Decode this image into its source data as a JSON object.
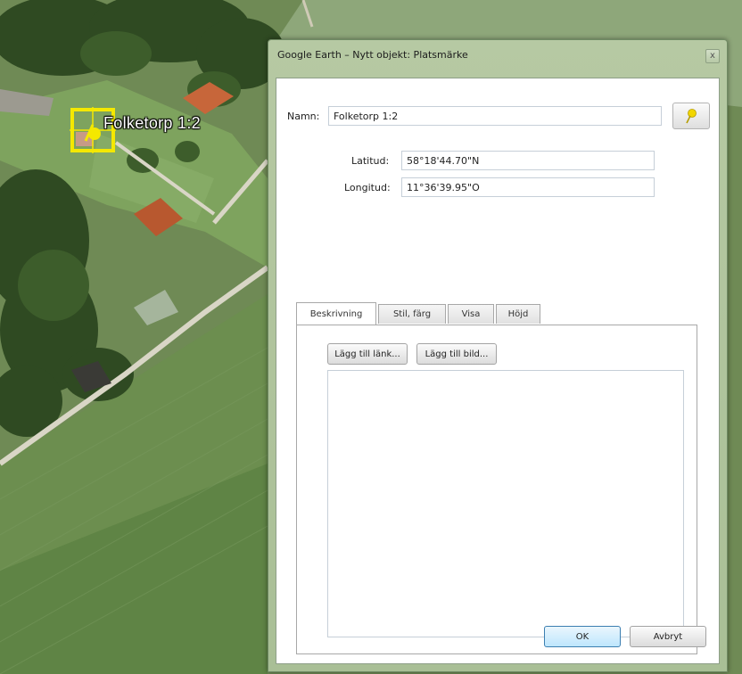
{
  "map": {
    "placemark_label": "Folketorp 1:2"
  },
  "dialog": {
    "title": "Google Earth – Nytt objekt: Platsmärke",
    "close_symbol": "x",
    "name_label": "Namn:",
    "name_value": "Folketorp 1:2",
    "pin_icon": "yellow-pushpin-icon",
    "latitude_label": "Latitud:",
    "latitude_value": "58°18'44.70\"N",
    "longitude_label": "Longitud:",
    "longitude_value": "11°36'39.95\"O",
    "tabs": [
      {
        "label": "Beskrivning",
        "active": true
      },
      {
        "label": "Stil, färg",
        "active": false
      },
      {
        "label": "Visa",
        "active": false
      },
      {
        "label": "Höjd",
        "active": false
      }
    ],
    "add_link_label": "Lägg till länk...",
    "add_image_label": "Lägg till bild...",
    "description_value": "",
    "ok_label": "OK",
    "cancel_label": "Avbryt"
  },
  "colors": {
    "placemark_yellow": "#f4e800",
    "dialog_frame": "#b3c69f",
    "ok_button_border": "#3c7fb1"
  }
}
